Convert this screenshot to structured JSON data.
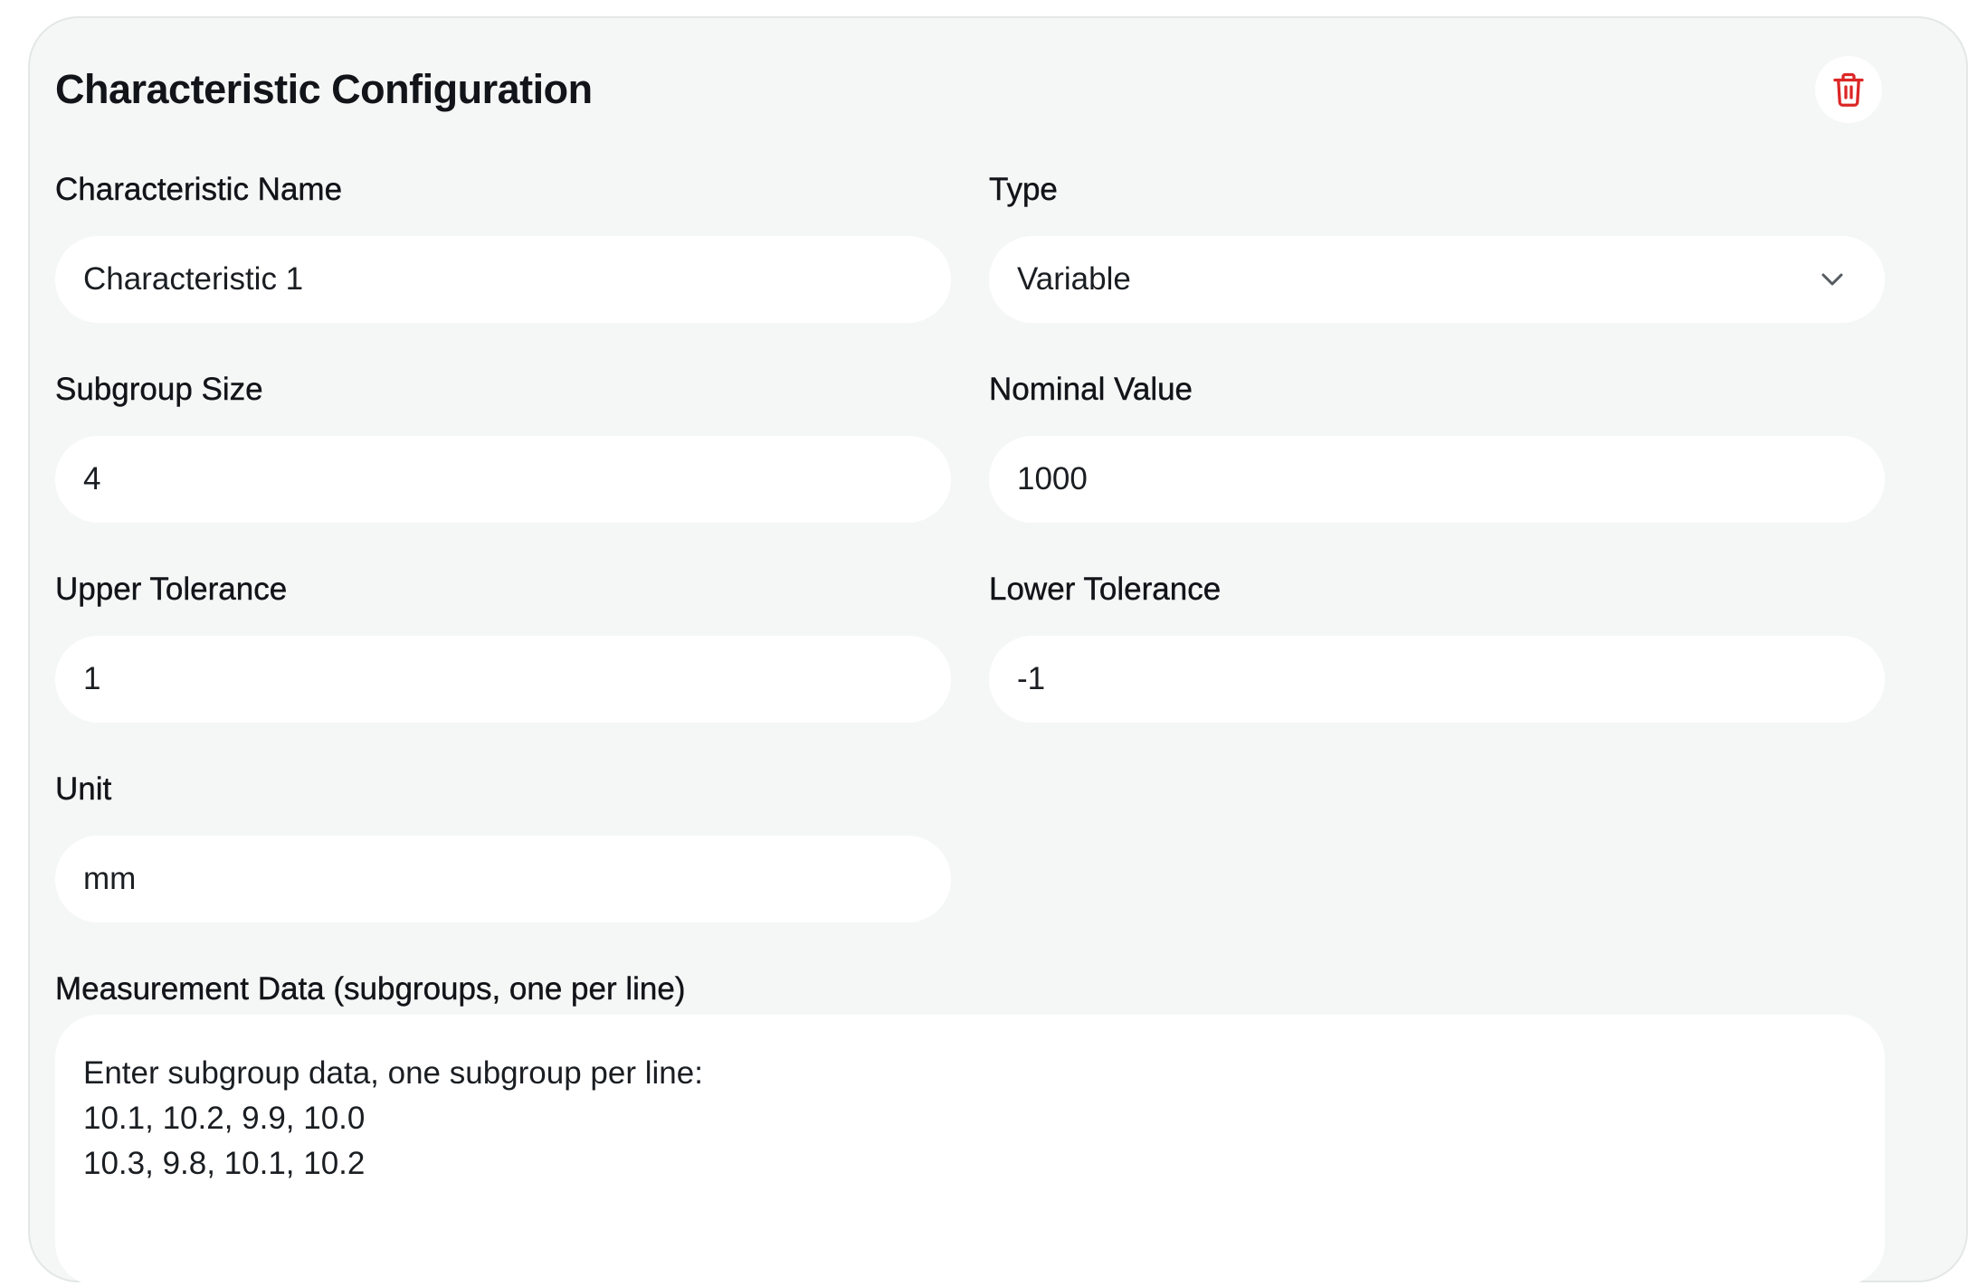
{
  "card": {
    "title": "Characteristic Configuration",
    "delete_icon": "trash-icon",
    "accent_delete": "#dc2626"
  },
  "form": {
    "name": {
      "label": "Characteristic Name",
      "value": "Characteristic 1"
    },
    "type": {
      "label": "Type",
      "value": "Variable",
      "icon": "chevron-down-icon"
    },
    "subgroup_size": {
      "label": "Subgroup Size",
      "value": "4"
    },
    "nominal_value": {
      "label": "Nominal Value",
      "value": "1000"
    },
    "upper_tolerance": {
      "label": "Upper Tolerance",
      "value": "1"
    },
    "lower_tolerance": {
      "label": "Lower Tolerance",
      "value": "-1"
    },
    "unit": {
      "label": "Unit",
      "value": "mm"
    },
    "measurement_data": {
      "label": "Measurement Data (subgroups, one per line)",
      "value": "Enter subgroup data, one subgroup per line:\n10.1, 10.2, 9.9, 10.0\n10.3, 9.8, 10.1, 10.2"
    }
  }
}
